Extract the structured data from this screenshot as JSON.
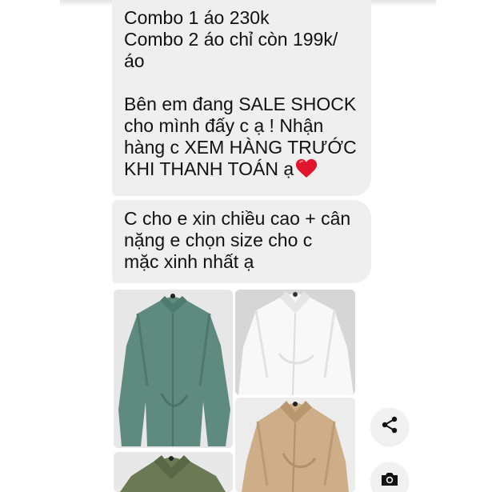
{
  "chat": {
    "message_1": {
      "text": "Combo 1 áo 230k\nCombo 2 áo chỉ còn 199k/\náo\n\nBên em đang SALE SHOCK\ncho mình đấy c ạ ! Nhận\nhàng c XEM HÀNG TRƯỚC\nKHI THANH TOÁN ạ",
      "emoji": "heart-emoji"
    },
    "message_2": {
      "text": "C cho e xin chiều cao + cân\nnặng e chọn size cho c\nmặc xinh nhất  ạ"
    },
    "photos": [
      {
        "name": "green-shirt-photo",
        "color": "#5f8a80"
      },
      {
        "name": "white-shirt-photo",
        "color": "#f7f7f7"
      },
      {
        "name": "beige-shirt-photo",
        "color": "#cdae88"
      },
      {
        "name": "olive-shirt-photo",
        "color": "#6b7a55"
      }
    ]
  },
  "actions": {
    "share_icon": "share-icon",
    "camera_icon": "camera-icon"
  },
  "colors": {
    "bubble_bg": "#efeff0",
    "text": "#111111",
    "heart": "#e0142b"
  }
}
